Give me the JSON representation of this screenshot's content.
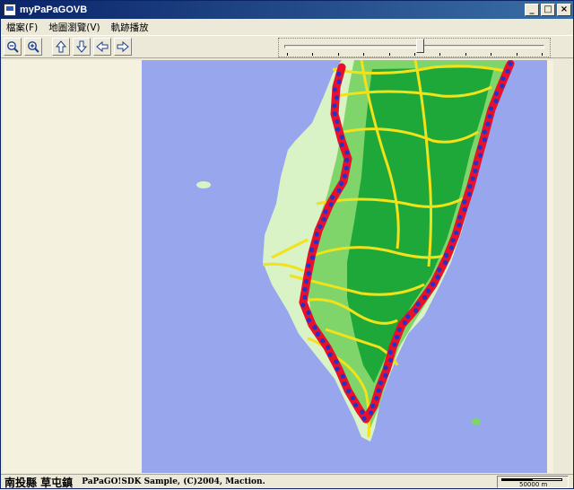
{
  "window": {
    "title": "myPaPaGOVB"
  },
  "title_buttons": {
    "minimize": "_",
    "maximize": "□",
    "close": "×"
  },
  "menu": [
    "檔案(F)",
    "地圖瀏覽(V)",
    "軌跡播放"
  ],
  "toolbar": {
    "buttons": [
      {
        "name": "zoom-out-button",
        "icon": "zoom-out-icon"
      },
      {
        "name": "zoom-in-button",
        "icon": "zoom-in-icon"
      },
      {
        "name": "pan-up-button",
        "icon": "arrow-up-icon"
      },
      {
        "name": "pan-down-button",
        "icon": "arrow-down-icon"
      },
      {
        "name": "pan-left-button",
        "icon": "arrow-left-icon"
      },
      {
        "name": "pan-right-button",
        "icon": "arrow-right-icon"
      }
    ],
    "playback_slider_fraction": 0.52
  },
  "status": {
    "place": "南投縣 草屯鎮",
    "copyright": "PaPaGO!SDK Sample, (C)2004, Maction.",
    "scale": "50000 m"
  },
  "colors": {
    "sea": "#98a6ee",
    "land_light": "#d9f2c6",
    "land_mid": "#7fd46a",
    "land_dark": "#1fa83a",
    "road": "#f2e21a",
    "track": "#e8102a",
    "track_point": "#2332c8"
  }
}
